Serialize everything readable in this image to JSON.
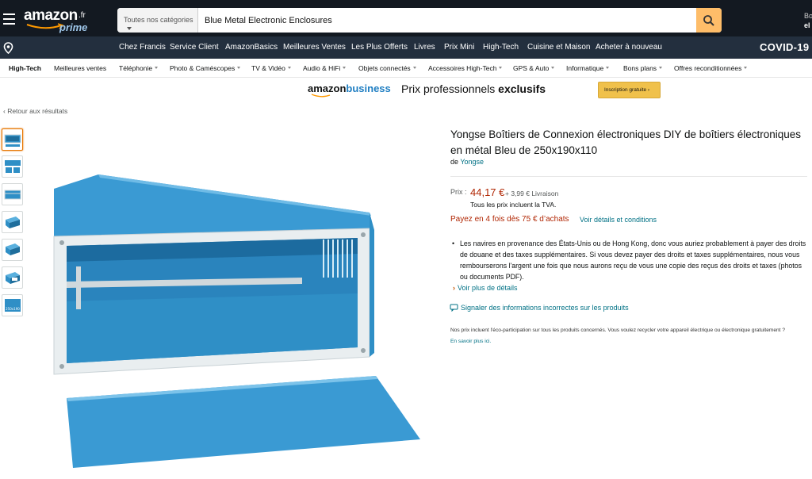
{
  "header": {
    "logo": {
      "word": "amazon",
      "tld": ".fr",
      "prime": "prime"
    },
    "search": {
      "category": "Toutes nos catégories",
      "value": "Blue Metal Electronic Enclosures"
    },
    "hello_line1": "Bonj",
    "hello_line2": "el"
  },
  "nav": {
    "items": [
      "Chez Francis",
      "Service Client",
      "AmazonBasics",
      "Meilleures Ventes",
      "Les Plus Offerts",
      "Livres",
      "Prix Mini",
      "High-Tech",
      "Cuisine et Maison",
      "Acheter à nouveau"
    ],
    "covid": "COVID-19"
  },
  "subnav": {
    "items": [
      "High-Tech",
      "Meilleures ventes",
      "Téléphonie",
      "Photo & Caméscopes",
      "TV & Vidéo",
      "Audio & HiFi",
      "Objets connectés",
      "Accessoires High-Tech",
      "GPS & Auto",
      "Informatique",
      "Bons plans",
      "Offres reconditionnées"
    ]
  },
  "business": {
    "logo_amazon": "amazon",
    "logo_business": "business",
    "tagline_regular": "Prix professionnels ",
    "tagline_bold": "exclusifs",
    "button": "Inscription gratuite  ›"
  },
  "back_link": "‹ Retour aux résultats",
  "thumbnail_labels": [
    "",
    "",
    "",
    "",
    "",
    "",
    "250x190"
  ],
  "product": {
    "title": "Yongse Boîtiers de Connexion électroniques DIY de boîtiers électroniques en métal Bleu de 250x190x110",
    "brand_prefix": "de ",
    "brand": "Yongse",
    "price_label": "Prix :",
    "price": "44,17 €",
    "shipping": "+ 3,99 € Livraison",
    "tva": "Tous les prix incluent la TVA.",
    "pay4": "Payez en 4 fois dès 75 € d’achats",
    "pay4_link": "Voir détails et conditions",
    "bullet": "Les navires en provenance des États-Unis ou de Hong Kong, donc vous auriez probablement à payer des droits de douane et des taxes supplémentaires. Si vous devez payer des droits et taxes supplémentaires, nous vous rembourserons l'argent une fois que nous aurons reçu de vous une copie des reçus des droits et taxes (photos ou documents PDF).",
    "more_link": "Voir plus de détails",
    "report_link": "Signaler des informations incorrectes sur les produits",
    "eco_text": "Nos prix incluent l'éco-participation sur tous les produits concernés. Vous voulez recycler votre appareil électrique ou électronique gratuitement ? ",
    "eco_link": "En savoir plus ici."
  },
  "colors": {
    "header_bg": "#131921",
    "nav_bg": "#232f3e",
    "search_button": "#febd69",
    "price_red": "#b12704",
    "link_teal": "#007185",
    "enclosure_blue": "#2f8fc6"
  }
}
